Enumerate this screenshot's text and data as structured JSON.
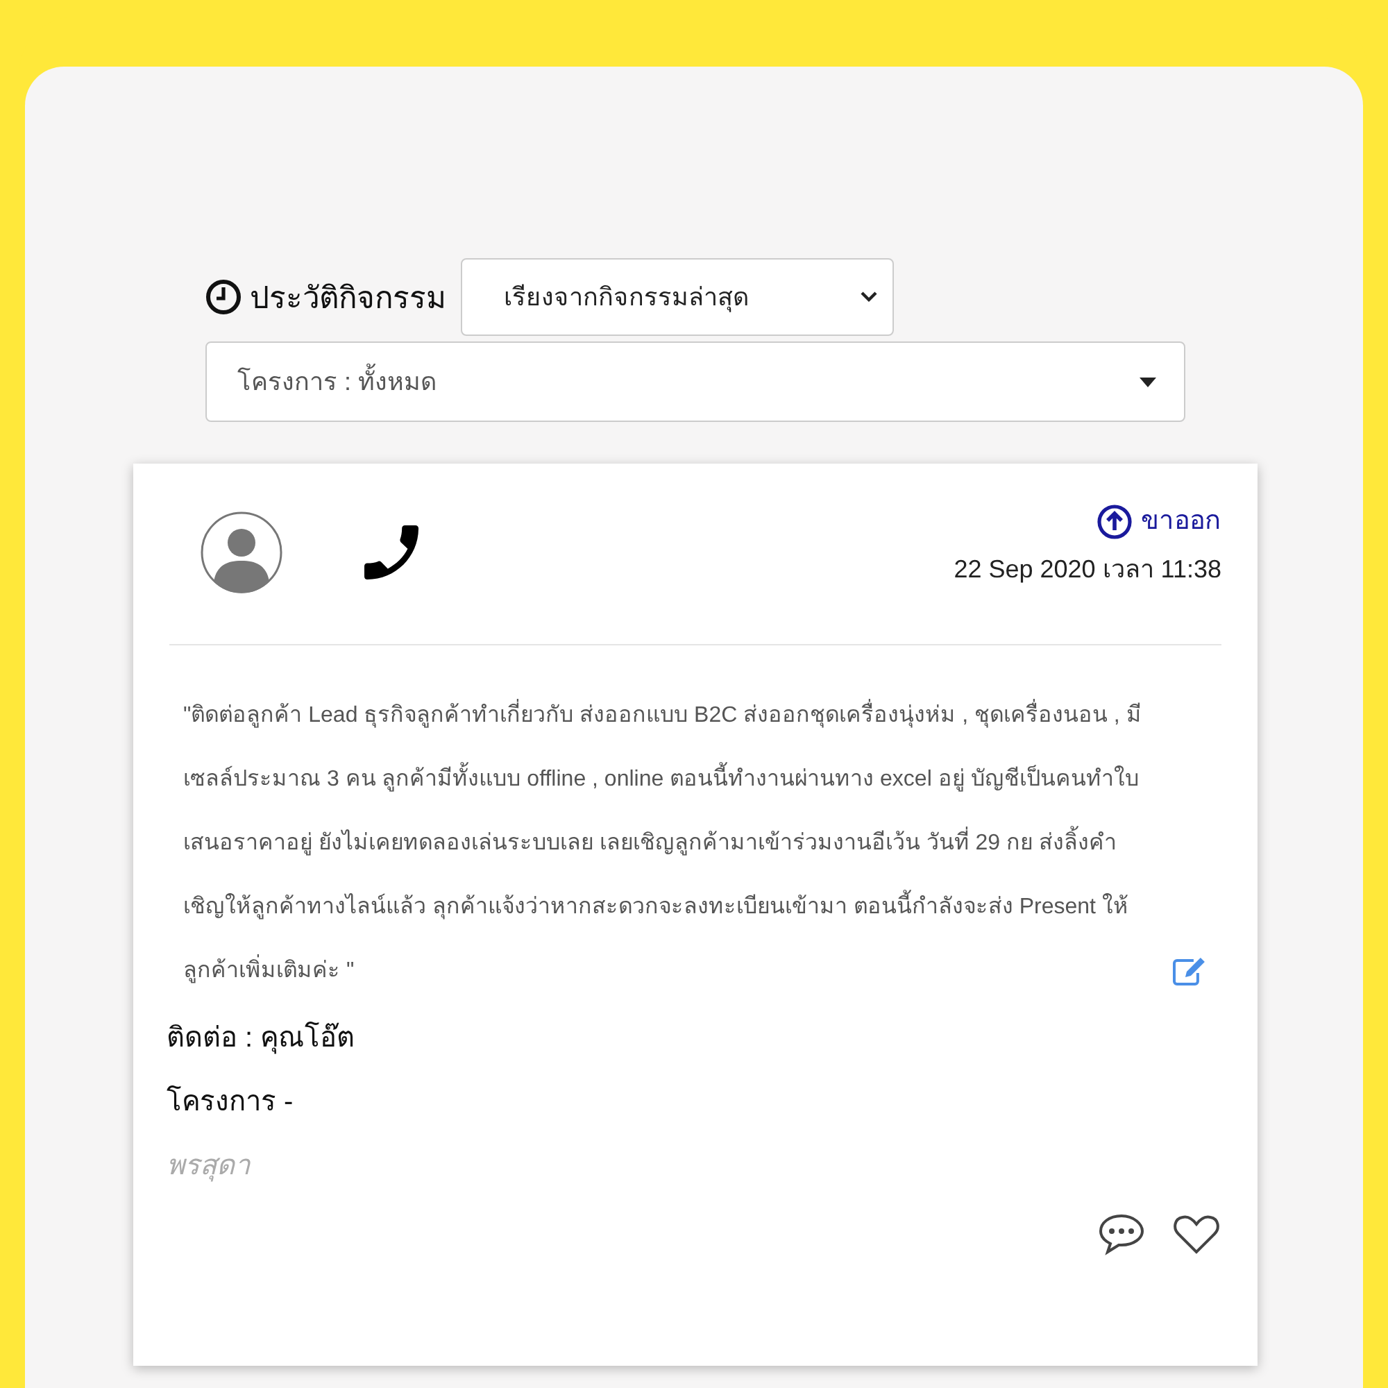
{
  "history": {
    "title": "ประวัติกิจกรรม",
    "sort_select": {
      "value": "เรียงจากกิจกรรมล่าสุด"
    },
    "project_select": {
      "value": "โครงการ : ทั้งหมด"
    }
  },
  "activity": {
    "direction": "ขาออก",
    "datetime": "22 Sep 2020 เวลา 11:38",
    "note": "\"ติดต่อลูกค้า Lead ธุรกิจลูกค้าทำเกี่ยวกับ ส่งออกแบบ B2C ส่งออกชุดเครื่องนุ่งห่ม , ชุดเครื่องนอน , มีเซลล์ประมาณ 3 คน ลูกค้ามีทั้งแบบ offline , online ตอนนี้ทำงานผ่านทาง excel อยู่ บัญชีเป็นคนทำใบเสนอราคาอยู่ ยังไม่เคยทดลองเล่นระบบเลย เลยเชิญลูกค้ามาเข้าร่วมงานอีเว้น วันที่ 29 กย ส่งลิ้งคำเชิญให้ลูกค้าทางไลน์แล้ว ลุกค้าแจ้งว่าหากสะดวกจะลงทะเบียนเข้ามา ตอนนี้กำลังจะส่ง Present ให้ลูกค้าเพิ่มเติมค่ะ \"",
    "contact": "ติดต่อ : คุณโอ๊ต",
    "project": "โครงการ -",
    "author": "พรสุดา",
    "liked": false
  }
}
